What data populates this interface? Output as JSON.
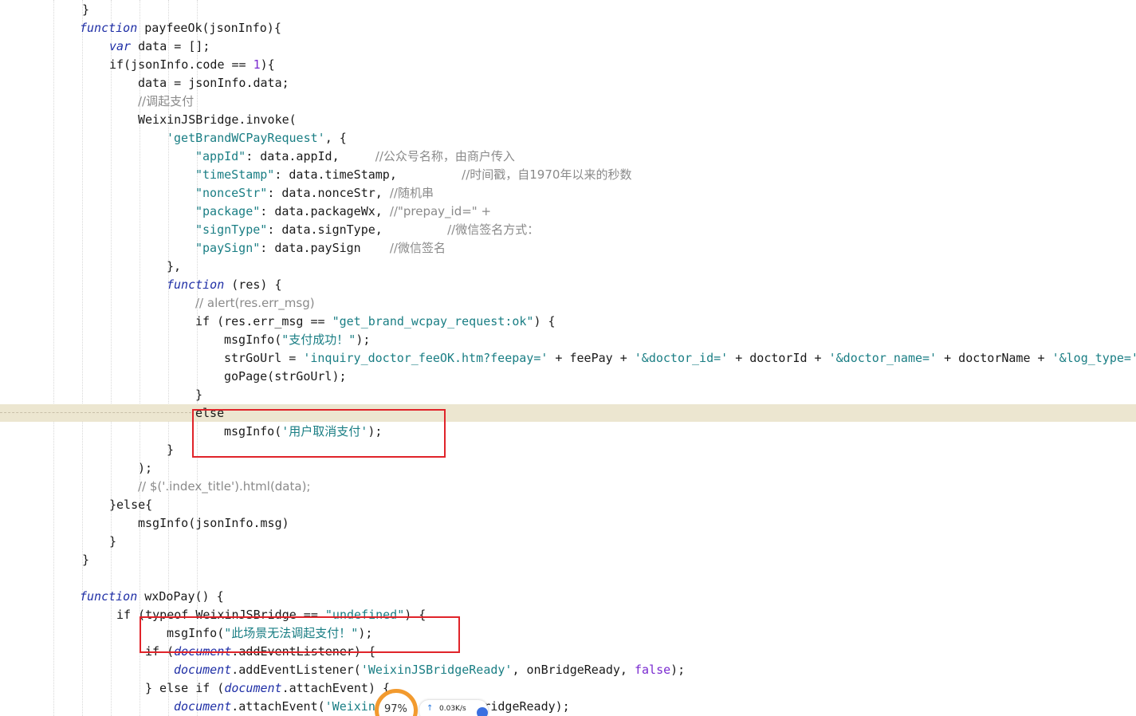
{
  "lines": [
    {
      "segments": [
        [
          "plain",
          "}"
        ]
      ]
    },
    {
      "segments": [
        [
          "kw",
          "function"
        ],
        [
          "plain",
          " payfeeOk(jsonInfo){"
        ]
      ]
    },
    {
      "segments": [
        [
          "kw",
          "var"
        ],
        [
          "plain",
          " data = [];"
        ]
      ]
    },
    {
      "segments": [
        [
          "plain",
          "if(jsonInfo.code == "
        ],
        [
          "num",
          "1"
        ],
        [
          "plain",
          "){"
        ]
      ]
    },
    {
      "segments": [
        [
          "plain",
          "data = jsonInfo.data;"
        ]
      ]
    },
    {
      "segments": [
        [
          "cmt",
          "//调起支付"
        ]
      ]
    },
    {
      "segments": [
        [
          "plain",
          "WeixinJSBridge.invoke("
        ]
      ]
    },
    {
      "segments": [
        [
          "str",
          "'getBrandWCPayRequest'"
        ],
        [
          "plain",
          ", {"
        ]
      ]
    },
    {
      "segments": [
        [
          "str",
          "\"appId\""
        ],
        [
          "plain",
          ": data.appId,     "
        ],
        [
          "cmt",
          "//公众号名称，由商户传入"
        ]
      ]
    },
    {
      "segments": [
        [
          "str",
          "\"timeStamp\""
        ],
        [
          "plain",
          ": data.timeStamp,         "
        ],
        [
          "cmt",
          "//时间戳，自1970年以来的秒数"
        ]
      ]
    },
    {
      "segments": [
        [
          "str",
          "\"nonceStr\""
        ],
        [
          "plain",
          ": data.nonceStr, "
        ],
        [
          "cmt",
          "//随机串"
        ]
      ]
    },
    {
      "segments": [
        [
          "str",
          "\"package\""
        ],
        [
          "plain",
          ": data.packageWx, "
        ],
        [
          "cmt",
          "//\"prepay_id=\" +"
        ]
      ]
    },
    {
      "segments": [
        [
          "str",
          "\"signType\""
        ],
        [
          "plain",
          ": data.signType,         "
        ],
        [
          "cmt",
          "//微信签名方式："
        ]
      ]
    },
    {
      "segments": [
        [
          "str",
          "\"paySign\""
        ],
        [
          "plain",
          ": data.paySign    "
        ],
        [
          "cmt",
          "//微信签名"
        ]
      ]
    },
    {
      "segments": [
        [
          "plain",
          "},"
        ]
      ]
    },
    {
      "segments": [
        [
          "kw",
          "function"
        ],
        [
          "plain",
          " (res) {"
        ]
      ]
    },
    {
      "segments": [
        [
          "cmt",
          "// alert(res.err_msg)"
        ]
      ]
    },
    {
      "segments": [
        [
          "plain",
          "if (res.err_msg == "
        ],
        [
          "str",
          "\"get_brand_wcpay_request:ok\""
        ],
        [
          "plain",
          ") {"
        ]
      ]
    },
    {
      "segments": [
        [
          "plain",
          "msgInfo("
        ],
        [
          "str",
          "\"支付成功！\""
        ],
        [
          "plain",
          ");"
        ]
      ]
    },
    {
      "segments": [
        [
          "plain",
          "strGoUrl = "
        ],
        [
          "str",
          "'inquiry_doctor_feeOK.htm?feepay='"
        ],
        [
          "plain",
          " + feePay + "
        ],
        [
          "str",
          "'&doctor_id='"
        ],
        [
          "plain",
          " + doctorId + "
        ],
        [
          "str",
          "'&doctor_name='"
        ],
        [
          "plain",
          " + doctorName + "
        ],
        [
          "str",
          "'&log_type='"
        ]
      ]
    },
    {
      "segments": [
        [
          "plain",
          "goPage(strGoUrl);"
        ]
      ]
    },
    {
      "segments": [
        [
          "plain",
          "}"
        ]
      ]
    },
    {
      "segments": [
        [
          "plain",
          "else"
        ]
      ]
    },
    {
      "segments": [
        [
          "plain",
          "msgInfo("
        ],
        [
          "str",
          "'用户取消支付'"
        ],
        [
          "plain",
          ");"
        ]
      ]
    },
    {
      "segments": [
        [
          "plain",
          "}"
        ]
      ]
    },
    {
      "segments": [
        [
          "plain",
          ");"
        ]
      ]
    },
    {
      "segments": [
        [
          "cmt",
          "// $('.index_title').html(data);"
        ]
      ]
    },
    {
      "segments": [
        [
          "plain",
          "}else{"
        ]
      ]
    },
    {
      "segments": [
        [
          "plain",
          "msgInfo(jsonInfo.msg)"
        ]
      ]
    },
    {
      "segments": [
        [
          "plain",
          "}"
        ]
      ]
    },
    {
      "segments": [
        [
          "plain",
          "}"
        ]
      ]
    },
    {
      "segments": []
    },
    {
      "segments": [
        [
          "kw",
          "function"
        ],
        [
          "plain",
          " wxDoPay() {"
        ]
      ]
    },
    {
      "segments": [
        [
          "plain",
          "if (typeof WeixinJSBridge == "
        ],
        [
          "str",
          "\"undefined\""
        ],
        [
          "plain",
          ") {"
        ]
      ]
    },
    {
      "segments": [
        [
          "plain",
          "msgInfo("
        ],
        [
          "str",
          "\"此场景无法调起支付！\""
        ],
        [
          "plain",
          ");"
        ]
      ]
    },
    {
      "segments": [
        [
          "plain",
          "if ("
        ],
        [
          "doc",
          "document"
        ],
        [
          "plain",
          ".addEventListener) {"
        ]
      ]
    },
    {
      "segments": [
        [
          "doc",
          "document"
        ],
        [
          "plain",
          ".addEventListener("
        ],
        [
          "str",
          "'WeixinJSBridgeReady'"
        ],
        [
          "plain",
          ", onBridgeReady, "
        ],
        [
          "bool",
          "false"
        ],
        [
          "plain",
          ");"
        ]
      ]
    },
    {
      "segments": [
        [
          "plain",
          "} else if ("
        ],
        [
          "doc",
          "document"
        ],
        [
          "plain",
          ".attachEvent) {"
        ]
      ]
    },
    {
      "segments": [
        [
          "doc",
          "document"
        ],
        [
          "plain",
          ".attachEvent("
        ],
        [
          "str",
          "'Weixin"
        ],
        [
          "plain",
          "            onBridgeReady);"
        ]
      ]
    }
  ],
  "network_widget": {
    "percent": "97%",
    "upload_speed": "0.03K/s",
    "upload_arrow": "↑"
  }
}
